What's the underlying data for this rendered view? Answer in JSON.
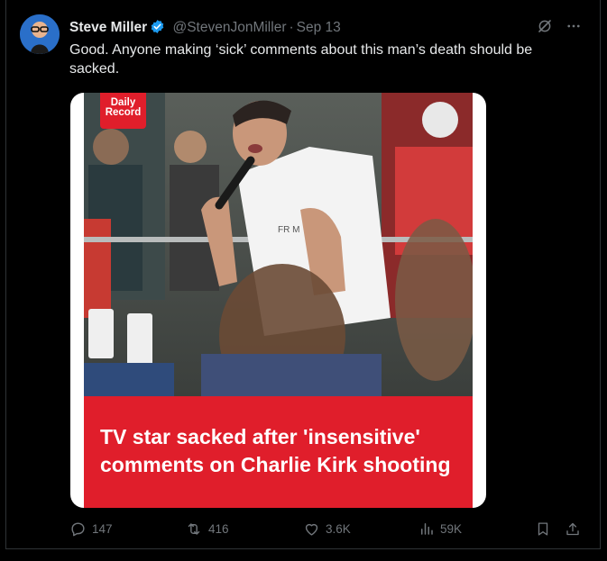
{
  "tweet": {
    "author_name": "Steve Miller",
    "handle": "@StevenJonMiller",
    "separator": "·",
    "date": "Sep 13",
    "text": "Good. Anyone making ‘sick’ comments about this man’s death should be sacked.",
    "verified": true
  },
  "media": {
    "logo_line1": "Daily",
    "logo_line2": "Record",
    "headline": "TV star sacked after 'insensitive' comments on Charlie Kirk shooting",
    "shirt_text": "FR  M",
    "banner_color": "#e01e2b"
  },
  "actions": {
    "replies": "147",
    "reposts": "416",
    "likes": "3.6K",
    "views": "59K"
  },
  "colors": {
    "background": "#000000",
    "text": "#e7e9ea",
    "muted": "#71767b",
    "verified": "#1d9bf0"
  },
  "icons": [
    "grok-icon",
    "more-icon",
    "reply-icon",
    "repost-icon",
    "like-icon",
    "views-icon",
    "bookmark-icon",
    "share-icon",
    "verified-badge-icon"
  ]
}
